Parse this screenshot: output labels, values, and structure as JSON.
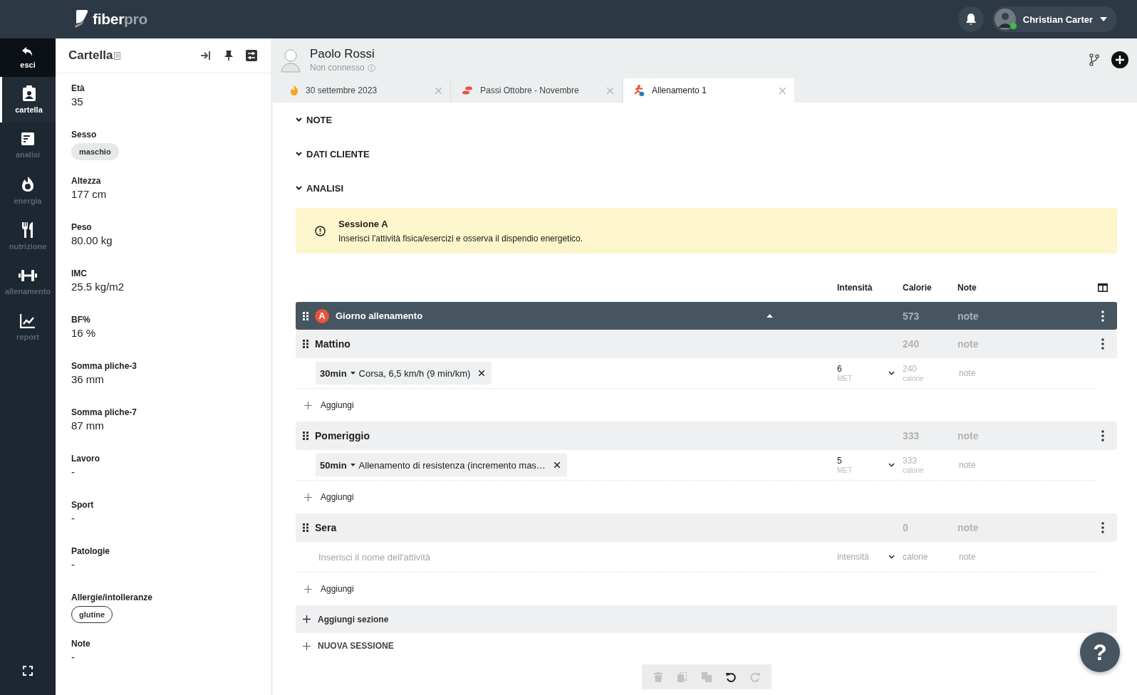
{
  "topbar": {
    "logo": {
      "part_1": "fiber",
      "part_2": "pro"
    },
    "user": {
      "name": "Christian Carter",
      "online": true
    }
  },
  "nav": {
    "exit": {
      "label": "esci"
    },
    "items": [
      {
        "label": "cartella",
        "selected": true
      },
      {
        "label": "analisi",
        "selected": false
      },
      {
        "label": "energia",
        "selected": false
      },
      {
        "label": "nutrizione",
        "selected": false
      },
      {
        "label": "allenamento",
        "selected": false
      },
      {
        "label": "report",
        "selected": false
      }
    ]
  },
  "panel": {
    "title": "Cartella",
    "fields": [
      {
        "label": "Età",
        "kind": "text",
        "value": "35"
      },
      {
        "label": "Sesso",
        "kind": "chip",
        "value": "maschio"
      },
      {
        "label": "Altezza",
        "kind": "text",
        "value": "177 cm"
      },
      {
        "label": "Peso",
        "kind": "text",
        "value": "80.00 kg"
      },
      {
        "label": "IMC",
        "kind": "text",
        "value": "25.5 kg/m2"
      },
      {
        "label": "BF%",
        "kind": "text",
        "value": "16 %"
      },
      {
        "label": "Somma pliche-3",
        "kind": "text",
        "value": "36 mm"
      },
      {
        "label": "Somma pliche-7",
        "kind": "text",
        "value": "87 mm"
      },
      {
        "label": "Lavoro",
        "kind": "text",
        "value": "-"
      },
      {
        "label": "Sport",
        "kind": "text",
        "value": "-"
      },
      {
        "label": "Patologie",
        "kind": "text",
        "value": "-"
      },
      {
        "label": "Allergie/intolleranze",
        "kind": "outlined_chip",
        "value": "glutine"
      },
      {
        "label": "Note",
        "kind": "text",
        "value": "-"
      }
    ]
  },
  "patient": {
    "name": "Paolo Rossi",
    "status": "Non connesso"
  },
  "tabs": [
    {
      "label": "30 settembre 2023",
      "selected": false
    },
    {
      "label": "Passi Ottobre - Novembre",
      "selected": false
    },
    {
      "label": "Allenamento 1",
      "selected": true
    }
  ],
  "sections": [
    "NOTE",
    "DATI CLIENTE",
    "ANALISI"
  ],
  "alert": {
    "title": "Sessione A",
    "text": "Inserisci l'attività fisica/esercizi e osserva il dispendio energetico."
  },
  "columns": [
    "Intensità",
    "Calorie",
    "Note"
  ],
  "session": {
    "badge": "A",
    "title": "Giorno allenamento",
    "calories": "573",
    "note": "note"
  },
  "groups": [
    {
      "name": "Mattino",
      "calories": "240",
      "note": "note",
      "add_label": "Aggiungi",
      "activities": [
        {
          "kind": "activity",
          "duration": "30min",
          "name": "Corsa, 6,5 km/h (9 min/km)",
          "intensity": "6",
          "intensity_unit": "MET",
          "calories": "240",
          "calories_unit": "calorie",
          "note": "note"
        }
      ]
    },
    {
      "name": "Pomeriggio",
      "calories": "333",
      "note": "note",
      "add_label": "Aggiungi",
      "activities": [
        {
          "kind": "activity",
          "duration": "50min",
          "name": "Allenamento di resistenza (incremento mas…",
          "intensity": "5",
          "intensity_unit": "MET",
          "calories": "333",
          "calories_unit": "calorie",
          "note": "note"
        }
      ]
    },
    {
      "name": "Sera",
      "calories": "0",
      "note": "note",
      "add_label": "Aggiungi",
      "activities": [
        {
          "kind": "input",
          "placeholder": "Inserisci il nome dell'attività",
          "intensity_placeholder": "intensità",
          "calories_placeholder": "calorie",
          "note": "note"
        }
      ]
    }
  ],
  "add_section": "Aggiungi sezione",
  "new_session": "NUOVA SESSIONE",
  "toolbar": [
    {
      "disabled": true
    },
    {
      "disabled": true
    },
    {
      "disabled": true
    },
    {
      "disabled": false
    },
    {
      "disabled": true
    }
  ],
  "help": "?"
}
